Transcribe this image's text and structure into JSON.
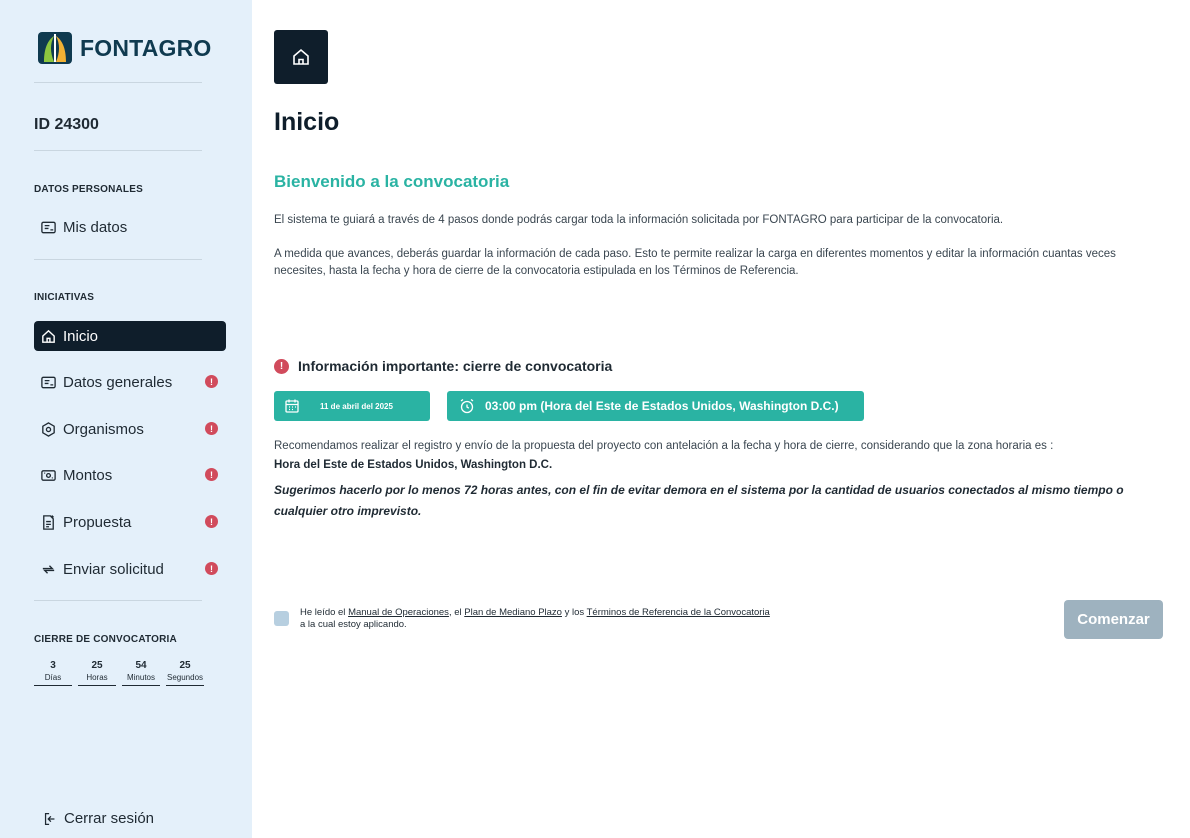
{
  "brand": {
    "name": "FONTAGRO"
  },
  "sidebar": {
    "id_label": "ID 24300",
    "personal_section": "DATOS PERSONALES",
    "my_data": "Mis datos",
    "initiatives_section": "INICIATIVAS",
    "items": [
      {
        "label": "Inicio",
        "icon": "home-icon",
        "active": true,
        "badge": ""
      },
      {
        "label": "Datos generales",
        "icon": "id-card-icon",
        "active": false,
        "badge": "!"
      },
      {
        "label": "Organismos",
        "icon": "org-icon",
        "active": false,
        "badge": "!"
      },
      {
        "label": "Montos",
        "icon": "money-icon",
        "active": false,
        "badge": "!"
      },
      {
        "label": "Propuesta",
        "icon": "document-icon",
        "active": false,
        "badge": "!"
      },
      {
        "label": "Enviar solicitud",
        "icon": "send-icon",
        "active": false,
        "badge": "!"
      }
    ],
    "closing_section": "CIERRE DE CONVOCATORIA",
    "countdown": [
      {
        "value": "3",
        "label": "Días"
      },
      {
        "value": "25",
        "label": "Horas"
      },
      {
        "value": "54",
        "label": "Minutos"
      },
      {
        "value": "25",
        "label": "Segundos"
      }
    ],
    "logout": "Cerrar sesión"
  },
  "main": {
    "title": "Inicio",
    "welcome": "Bienvenido a la convocatoria",
    "para1": "El sistema te guiará a través de 4 pasos donde podrás cargar toda la información solicitada por FONTAGRO para participar de la convocatoria.",
    "para2": "A medida que avances, deberás guardar la información de cada paso. Esto te permite realizar la carga en diferentes momentos y editar la información cuantas veces necesites, hasta la fecha y hora de cierre de la convocatoria estipulada en los Términos de Referencia.",
    "info_title": "Información importante: cierre de convocatoria",
    "date_pill": "11 de abril del 2025",
    "time_pill": "03:00 pm (Hora del Este de Estados Unidos, Washington D.C.)",
    "recommendation": "Recomendamos realizar el registro y envío de la propuesta del proyecto con antelación a la fecha y hora de cierre, considerando que la zona horaria es :",
    "timezone": "Hora del Este de Estados Unidos, Washington D.C.",
    "suggestion": "Sugerimos hacerlo por lo menos 72 horas antes, con el fin de evitar demora en el sistema por la cantidad de usuarios conectados al mismo tiempo o cualquier otro imprevisto.",
    "consent": {
      "part1": "He leído el ",
      "link1": "Manual de Operaciones",
      "part2": ", el ",
      "link2": "Plan de Mediano Plazo",
      "part3": " y los ",
      "link3": "Términos de Referencia de la Convocatoria",
      "line2": "a la cual estoy aplicando."
    },
    "start_button": "Comenzar"
  },
  "colors": {
    "accent": "#2ab3a3",
    "dark": "#0f1e2b",
    "alert": "#d14b5c",
    "sidebar_bg": "#e4f0fa"
  }
}
